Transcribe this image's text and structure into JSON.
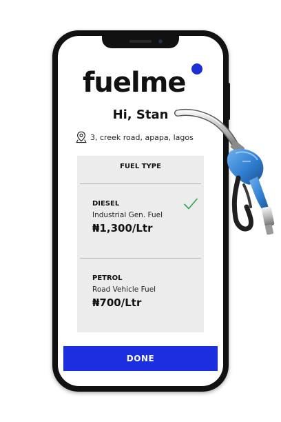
{
  "app": {
    "logo_text": "fuelme",
    "accent_color": "#1c2fe0"
  },
  "greeting": "Hi, Stan",
  "location": {
    "icon": "map-pin-icon",
    "address": "3, creek road, apapa, lagos"
  },
  "fuel_card": {
    "header": "FUEL TYPE",
    "options": [
      {
        "name": "DIESEL",
        "description": "Industrial Gen. Fuel",
        "price": "₦1,300/Ltr",
        "selected": true
      },
      {
        "name": "PETROL",
        "description": "Road Vehicle Fuel",
        "price": "₦700/Ltr",
        "selected": false
      }
    ]
  },
  "done_button": {
    "label": "DONE"
  },
  "colors": {
    "card_background": "#ececec",
    "check_color": "#2ea44f",
    "nozzle_blue": "#2f7fd0"
  }
}
